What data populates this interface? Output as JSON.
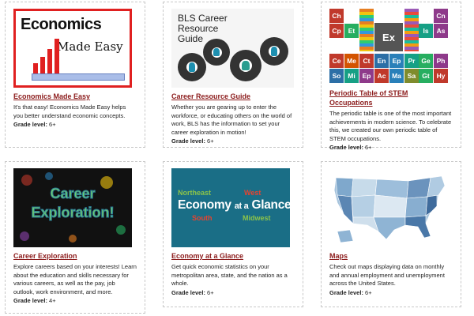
{
  "cards": [
    {
      "title": "Economics Made Easy",
      "description": "It's that easy! Economics Made Easy helps you better understand economic concepts.",
      "grade_label": "Grade level:",
      "grade_value": "6+",
      "image_text": [
        "Economics",
        "Made Easy"
      ]
    },
    {
      "title": "Career Resource Guide",
      "description": "Whether you are gearing up to enter the workforce, or educating others on the world of work, BLS has the information to set your career exploration in motion!",
      "grade_label": "Grade level:",
      "grade_value": "6+",
      "image_text": "BLS Career Resource Guide"
    },
    {
      "title": "Periodic Table of STEM Occupations",
      "description": "The periodic table is one of the most important achievements in modern science. To celebrate this, we created our own periodic table of STEM occupations.",
      "grade_label": "Grade level:",
      "grade_value": "6+",
      "elements": [
        "Ch",
        "Cn",
        "Cp",
        "Et",
        "Is",
        "As",
        "Ex",
        "Ce",
        "Me",
        "Ct",
        "En",
        "Ep",
        "Pr",
        "Ge",
        "Ph",
        "So",
        "Mi",
        "Ep",
        "Ac",
        "Ma",
        "Sa",
        "Gt",
        "Hy"
      ]
    },
    {
      "title": "Career Exploration",
      "description": "Explore careers based on your interests! Learn about the education and skills necessary for various careers, as well as the pay, job outlook, work environment, and more.",
      "grade_label": "Grade level:",
      "grade_value": "4+",
      "image_text": [
        "Career",
        "Exploration!"
      ]
    },
    {
      "title": "Economy at a Glance",
      "description": "Get quick economic statistics on your metropolitan area, state, and the nation as a whole.",
      "grade_label": "Grade level:",
      "grade_value": "6+",
      "image_text": {
        "northeast": "Northeast",
        "west": "West",
        "main_a": "Economy",
        "main_b": "at a",
        "main_c": "Glance",
        "south": "South",
        "midwest": "Midwest"
      }
    },
    {
      "title": "Maps",
      "description": "Check out maps displaying data on monthly and annual employment and unemployment across the United States.",
      "grade_label": "Grade level:",
      "grade_value": "6+"
    }
  ],
  "colors": {
    "link": "#8b1a1a",
    "econ_red": "#e02020",
    "eag_bg": "#1a6e86",
    "eag_green": "#8bc34a",
    "eag_red": "#e8432f"
  }
}
